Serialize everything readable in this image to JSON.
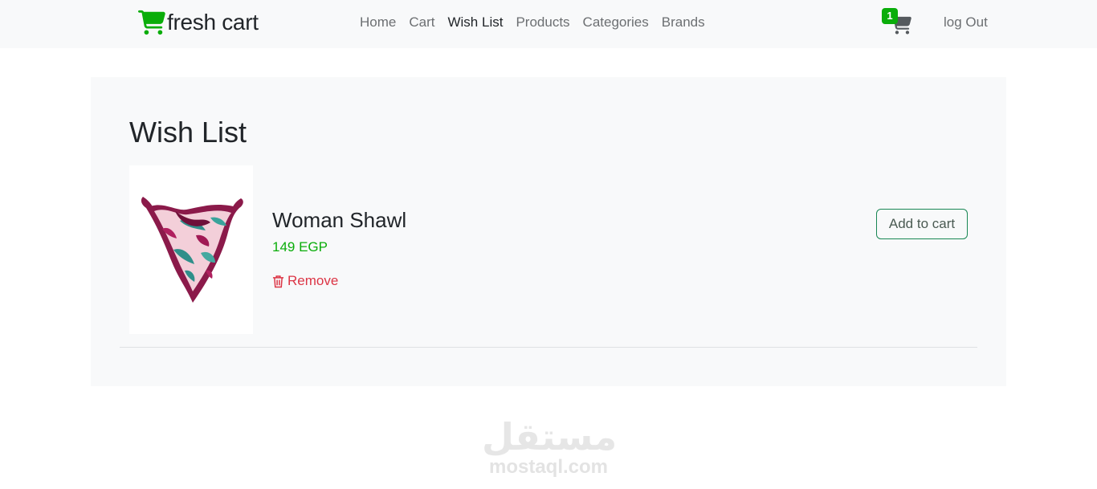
{
  "navbar": {
    "brand": "fresh cart",
    "links": [
      "Home",
      "Cart",
      "Wish List",
      "Products",
      "Categories",
      "Brands"
    ],
    "active_link": "Wish List",
    "cart_count": "1",
    "logout": "log Out"
  },
  "wishlist": {
    "title": "Wish List",
    "items": [
      {
        "name": "Woman Shawl",
        "price": "149 EGP",
        "remove_label": "Remove",
        "add_to_cart_label": "Add to cart"
      }
    ]
  },
  "watermark": {
    "arabic": "مستقل",
    "latin": "mostaql.com"
  },
  "colors": {
    "brand_green": "#0aad0a",
    "danger": "#dc3545",
    "panel_bg": "#f8f9fa"
  },
  "icons": [
    "shopping-cart-icon",
    "trash-icon"
  ]
}
